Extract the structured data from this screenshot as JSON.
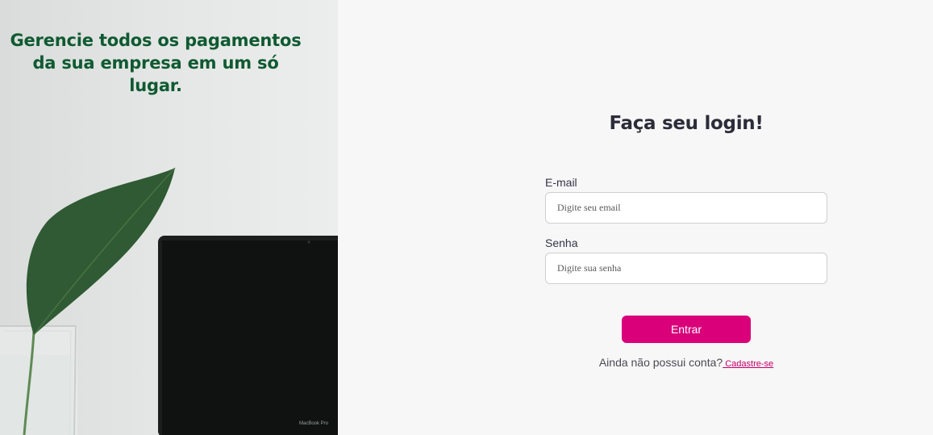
{
  "hero": {
    "headline": "Gerencie todos os pagamentos da sua empresa em um só lugar.",
    "laptop_caption": "MacBook Pro"
  },
  "login": {
    "title": "Faça seu login!",
    "email": {
      "label": "E-mail",
      "placeholder": "Digite seu email",
      "value": ""
    },
    "password": {
      "label": "Senha",
      "placeholder": "Digite sua senha",
      "value": ""
    },
    "submit_label": "Entrar",
    "signup_prompt": "Ainda não possui conta?",
    "signup_link": " Cadastre-se"
  },
  "colors": {
    "brand_pink": "#d9007a",
    "headline_green": "#0f5a31",
    "title_dark": "#2c2c3a",
    "panel_bg": "#f7f7f7"
  }
}
